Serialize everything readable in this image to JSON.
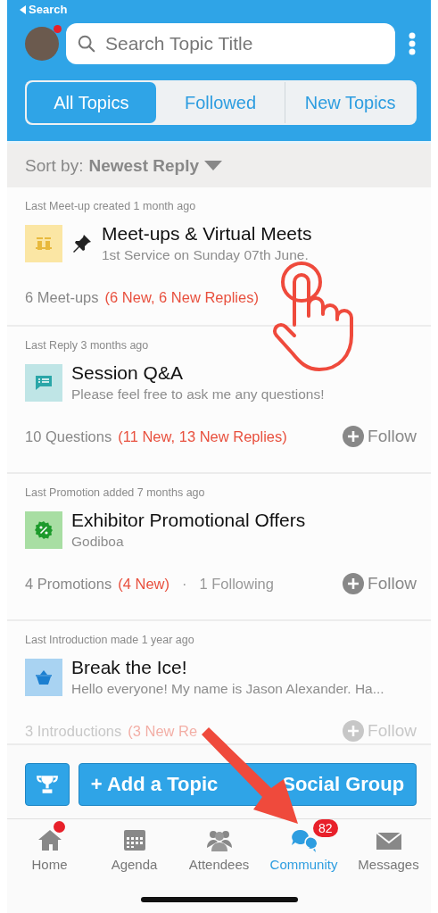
{
  "header": {
    "back_label": "Search",
    "avatar_notification": true,
    "search": {
      "placeholder": "Search Topic Title"
    },
    "tabs": [
      {
        "label": "All Topics",
        "selected": true
      },
      {
        "label": "Followed",
        "selected": false
      },
      {
        "label": "New Topics",
        "selected": false
      }
    ]
  },
  "sort": {
    "label": "Sort by:",
    "value": "Newest Reply"
  },
  "topics": [
    {
      "kind": "meetup",
      "activity": "Last Meet-up created 1 month ago",
      "title": "Meet-ups & Virtual Meets",
      "subtitle": "1st Service on Sunday 07th June.",
      "pinned": true,
      "count": "6 Meet-ups",
      "news": "(6 New, 6 New Replies)",
      "faded": false
    },
    {
      "kind": "qa",
      "activity": "Last Reply 3 months ago",
      "title": "Session Q&A",
      "subtitle": "Please feel free to ask me any questions!",
      "pinned": false,
      "count": "10 Questions",
      "news": "(11 New, 13 New Replies)",
      "follow": "Follow",
      "faded": false
    },
    {
      "kind": "promo",
      "activity": "Last Promotion added 7 months ago",
      "title": "Exhibitor Promotional Offers",
      "subtitle": "Godiboa",
      "pinned": false,
      "count": "4 Promotions",
      "news": "(4 New)",
      "separator": "·",
      "following": "1 Following",
      "follow": "Follow",
      "faded": false
    },
    {
      "kind": "ice",
      "activity": "Last Introduction made 1 year ago",
      "title": "Break the Ice!",
      "subtitle": "Hello everyone! My name is Jason Alexander. Ha...",
      "pinned": false,
      "count": "3 Introductions",
      "news": "(3 New Re",
      "follow": "Follow",
      "faded": true
    }
  ],
  "action_bar": {
    "add_label_start": "+ Add a Topic",
    "add_label_end": "Social Group"
  },
  "nav": [
    {
      "kind": "home",
      "label": "Home",
      "selected": false,
      "dot": true
    },
    {
      "kind": "agenda",
      "label": "Agenda",
      "selected": false,
      "dot": false
    },
    {
      "kind": "attendees",
      "label": "Attendees",
      "selected": false,
      "dot": false
    },
    {
      "kind": "community",
      "label": "Community",
      "selected": true,
      "dot": false,
      "badge": "82"
    },
    {
      "kind": "messages",
      "label": "Messages",
      "selected": false,
      "dot": false
    }
  ]
}
